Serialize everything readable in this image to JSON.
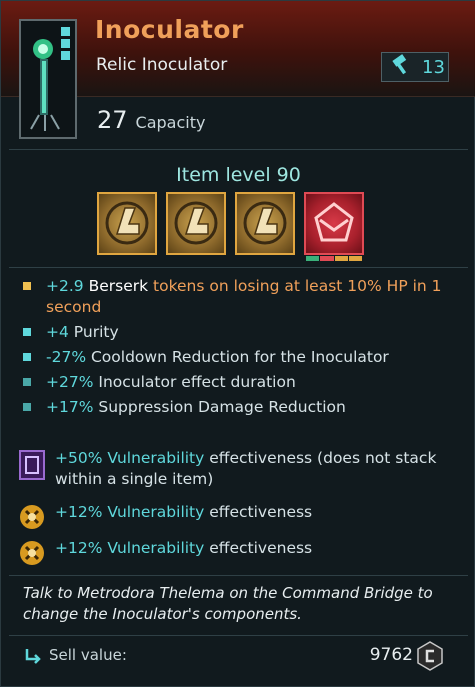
{
  "item": {
    "name": "Inoculator",
    "subtitle": "Relic Inoculator",
    "mod_level": "13",
    "capacity_value": "27",
    "capacity_label": "Capacity",
    "item_level": "Item level 90"
  },
  "stats": [
    {
      "value": "+2.9",
      "name": "Berserk",
      "rest": "tokens on losing at least 10% HP in 1 second",
      "bullet_color": "#f0c050"
    },
    {
      "value": "+4",
      "name": "Purity",
      "rest": "",
      "bullet_color": "#5fd8dc"
    },
    {
      "value": "-27%",
      "name": "Cooldown Reduction for the Inoculator",
      "rest": "",
      "bullet_color": "#5fd8dc"
    },
    {
      "value": "+27%",
      "name": "Inoculator effect duration",
      "rest": "",
      "bullet_color": "#4aa8a8"
    },
    {
      "value": "+17%",
      "name": "Suppression Damage Reduction",
      "rest": "",
      "bullet_color": "#4aa8a8"
    }
  ],
  "vulnerabilities": [
    {
      "value": "+50%",
      "name": "Vulnerability",
      "rest": "effectiveness (does not stack within a single item)",
      "icon": "purple-module-icon"
    },
    {
      "value": "+12%",
      "name": "Vulnerability",
      "rest": "effectiveness",
      "icon": "gold-vulnerability-icon"
    },
    {
      "value": "+12%",
      "name": "Vulnerability",
      "rest": "effectiveness",
      "icon": "gold-vulnerability-icon"
    }
  ],
  "note": "Talk to Metrodora Thelema on the Command Bridge to change the Inoculator's components.",
  "sell": {
    "label": "Sell value:",
    "value": "9762"
  },
  "colors": {
    "accent_orange": "#f0a05a",
    "accent_cyan": "#5fd8dc",
    "header_red": "#6b1b12"
  }
}
